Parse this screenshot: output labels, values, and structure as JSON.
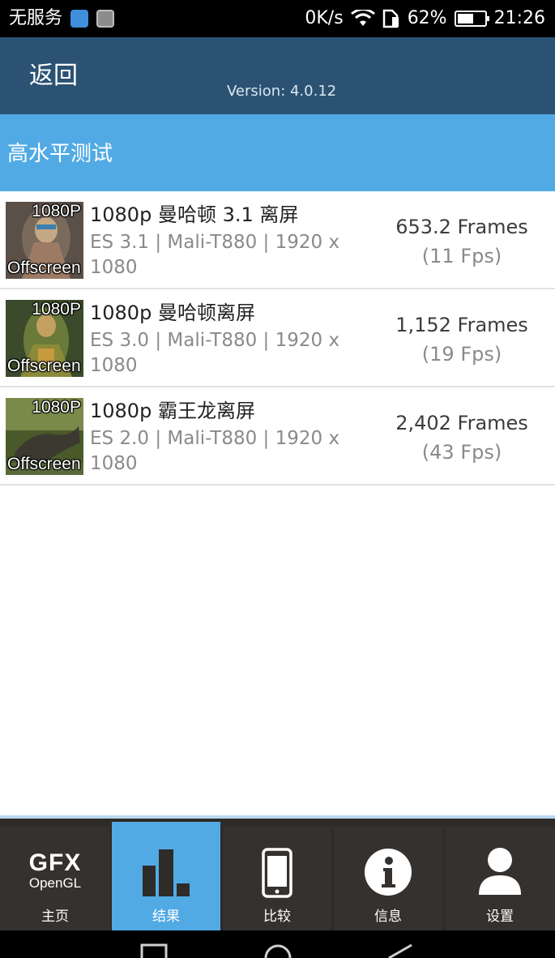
{
  "status_bar": {
    "carrier": "无服务",
    "net_speed": "0K/s",
    "battery": "62%",
    "battery_level": 0.62,
    "time": "21:26"
  },
  "header": {
    "back_label": "返回",
    "version": "Version: 4.0.12"
  },
  "section": {
    "title": "高水平测试"
  },
  "results": [
    {
      "thumb_top": "1080P",
      "thumb_bottom": "Offscreen",
      "title": "1080p 曼哈顿 3.1 离屏",
      "detail": "ES 3.1 | Mali-T880 | 1920 x 1080",
      "frames": "653.2 Frames",
      "fps": "(11 Fps)"
    },
    {
      "thumb_top": "1080P",
      "thumb_bottom": "Offscreen",
      "title": "1080p 曼哈顿离屏",
      "detail": "ES 3.0 | Mali-T880 | 1920 x 1080",
      "frames": "1,152 Frames",
      "fps": "(19 Fps)"
    },
    {
      "thumb_top": "1080P",
      "thumb_bottom": "Offscreen",
      "title": "1080p 霸王龙离屏",
      "detail": "ES 2.0 | Mali-T880 | 1920 x 1080",
      "frames": "2,402 Frames",
      "fps": "(43 Fps)"
    }
  ],
  "tabs": [
    {
      "label": "主页",
      "icon": "gfx-opengl-logo",
      "logo_main": "GFX",
      "logo_sub": "OpenGL",
      "active": false
    },
    {
      "label": "结果",
      "icon": "bar-chart-icon",
      "active": true
    },
    {
      "label": "比较",
      "icon": "phone-icon",
      "active": false
    },
    {
      "label": "信息",
      "icon": "info-icon",
      "active": false
    },
    {
      "label": "设置",
      "icon": "user-icon",
      "active": false
    }
  ],
  "colors": {
    "header": "#2b5273",
    "section": "#52aae5",
    "tab_bar": "#2e2b28",
    "tab_active": "#52aae5"
  }
}
